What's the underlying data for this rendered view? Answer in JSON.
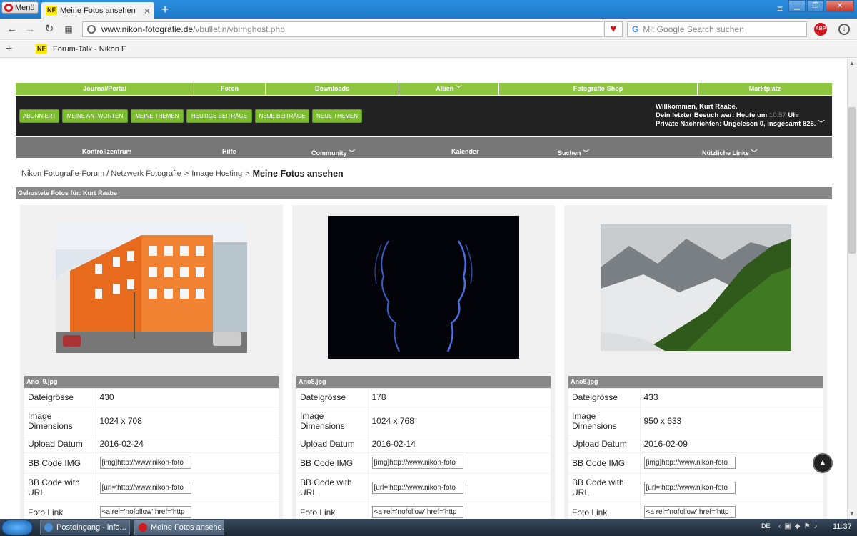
{
  "browser": {
    "menu_label": "Menü",
    "tab_badge": "NF",
    "tab_title": "Meine Fotos ansehen",
    "tab_close": "×",
    "new_tab": "+",
    "url_domain": "www.nikon-fotografie.de",
    "url_path": "/vbulletin/vbimghost.php",
    "search_placeholder": "Mit Google Search suchen",
    "search_g": "G",
    "abp": "ABP",
    "bookmark_add": "+",
    "bookmark_badge": "NF",
    "bookmark_label": "Forum-Talk - Nikon F"
  },
  "site": {
    "topnav": [
      "Journal/Portal",
      "Foren",
      "Downloads",
      "Alben",
      "Fotografie-Shop",
      "Marktplatz"
    ],
    "topnav_caret": "﹀",
    "buttons": [
      "ABONNIERT",
      "MEINE ANTWORTEN",
      "MEINE THEMEN",
      "HEUTIGE BEITRÄGE",
      "NEUE BEITRÄGE",
      "NEUE THEMEN"
    ],
    "welcome_line1": "Willkommen, Kurt Raabe.",
    "welcome_line2_a": "Dein letzter Besuch war: Heute um",
    "welcome_time": "10:57",
    "welcome_line2_b": "Uhr",
    "welcome_line3": "Private Nachrichten: Ungelesen 0, insgesamt 828.",
    "subnav": [
      "Kontrollzentrum",
      "Hilfe",
      "Community",
      "Kalender",
      "Suchen",
      "Nützliche Links"
    ],
    "breadcrumb": [
      "Nikon Fotografie-Forum / Netzwerk Fotografie",
      "Image Hosting"
    ],
    "breadcrumb_sep": ">",
    "page_title": "Meine Fotos ansehen",
    "hosted_header": "Gehostete Fotos für: Kurt Raabe"
  },
  "labels": {
    "size": "Dateigrösse",
    "dims": "Image Dimensions",
    "date": "Upload Datum",
    "bb_img": "BB Code IMG",
    "bb_url": "BB Code with URL",
    "link": "Foto Link"
  },
  "photos": [
    {
      "file": "Ano_9.jpg",
      "size": "430",
      "dims": "1024 x 708",
      "date": "2016-02-24",
      "bb_img": "[img]http://www.nikon-foto",
      "bb_url": "[url='http://www.nikon-foto",
      "link": "<a rel='nofollow' href='http"
    },
    {
      "file": "Ano8.jpg",
      "size": "178",
      "dims": "1024 x 768",
      "date": "2016-02-14",
      "bb_img": "[img]http://www.nikon-foto",
      "bb_url": "[url='http://www.nikon-foto",
      "link": "<a rel='nofollow' href='http"
    },
    {
      "file": "Ano5.jpg",
      "size": "433",
      "dims": "950 x 633",
      "date": "2016-02-09",
      "bb_img": "[img]http://www.nikon-foto",
      "bb_url": "[url='http://www.nikon-foto",
      "link": "<a rel='nofollow' href='http"
    }
  ],
  "taskbar": {
    "task1": "Posteingang - info...",
    "task2": "Meine Fotos ansehe...",
    "lang": "DE",
    "clock": "11:37"
  },
  "colors": {
    "green": "#8fc641",
    "dark": "#222222",
    "gray": "#777777"
  },
  "icons": [
    "back-icon",
    "forward-icon",
    "reload-icon",
    "speed-dial-icon",
    "heart-icon",
    "download-icon",
    "scroll-top-icon"
  ]
}
